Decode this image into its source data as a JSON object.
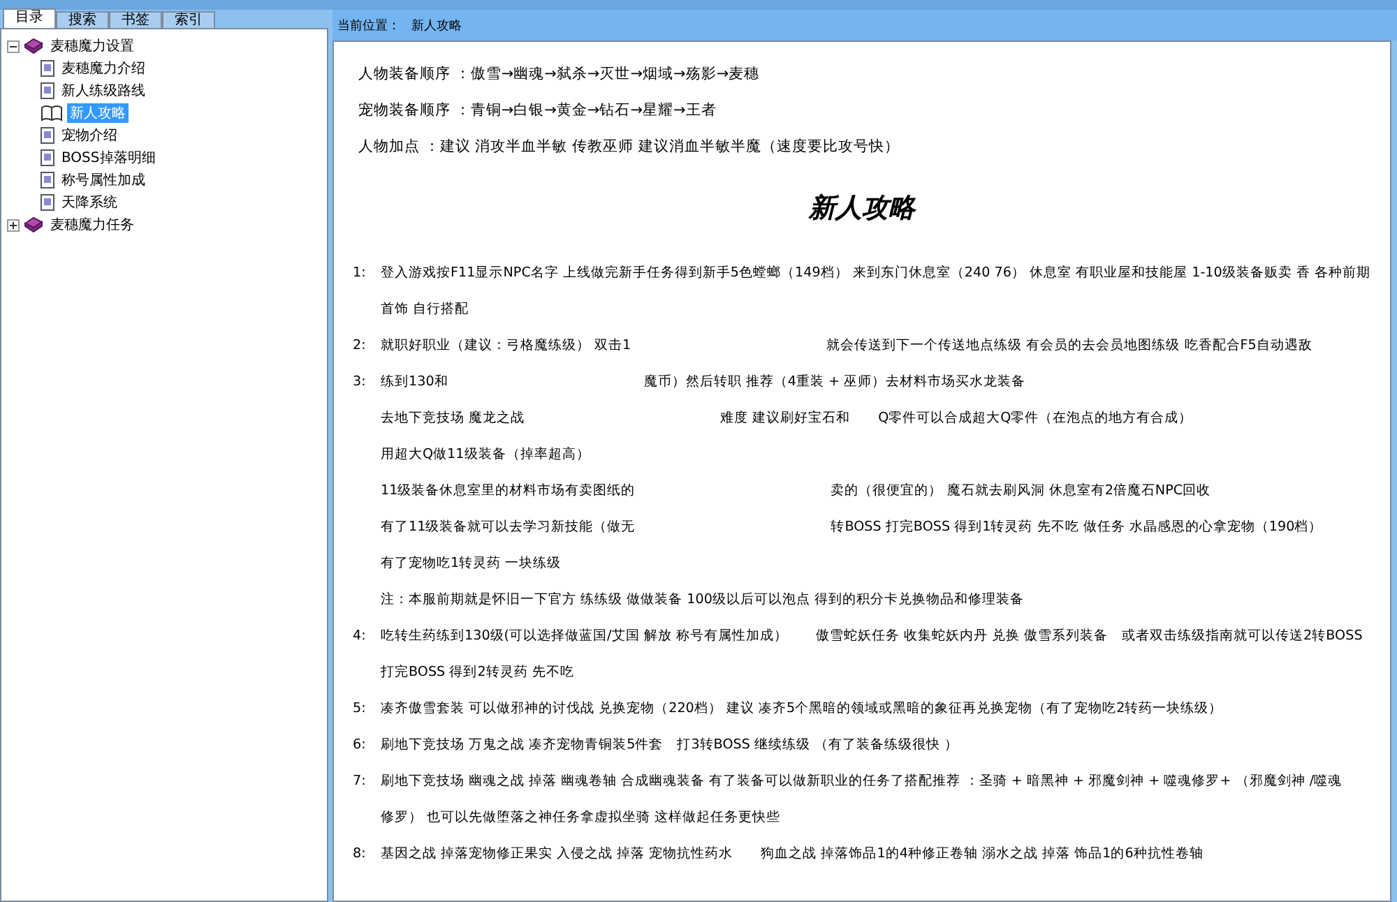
{
  "tabs": [
    {
      "label": "目录",
      "selected": true
    },
    {
      "label": "搜索",
      "selected": false
    },
    {
      "label": "书签",
      "selected": false
    },
    {
      "label": "索引",
      "selected": false
    }
  ],
  "tree": [
    {
      "label": "麦穗魔力设置",
      "expanded": true,
      "children": [
        {
          "label": "麦穗魔力介绍",
          "selected": false
        },
        {
          "label": "新人练级路线",
          "selected": false
        },
        {
          "label": "新人攻略",
          "selected": true
        },
        {
          "label": "宠物介绍",
          "selected": false
        },
        {
          "label": "BOSS掉落明细",
          "selected": false
        },
        {
          "label": "称号属性加成",
          "selected": false
        },
        {
          "label": "天降系统",
          "selected": false
        }
      ]
    },
    {
      "label": "麦穗魔力任务",
      "expanded": false
    }
  ],
  "location": {
    "label": "当前位置：",
    "value": "新人攻略"
  },
  "intro": [
    "人物装备顺序 ：傲雪→幽魂→弑杀→灭世→烟域→殇影→麦穗",
    "宠物装备顺序 ：青铜→白银→黄金→钻石→星耀→王者",
    "人物加点 ：建议 消攻半血半敏 传教巫师 建议消血半敏半魔（速度要比攻号快）"
  ],
  "heading": "新人攻略",
  "lines": [
    {
      "kind": "numbered",
      "number": "1:",
      "parts": [
        "登入游戏按F11显示NPC名字 上线做完新手任务得到新手5色螳螂（149档） 来到东门休息室（240 76） 休息室 有职业屋和技能屋 1-10级装备贩卖 香 各种前期"
      ]
    },
    {
      "kind": "indent",
      "parts": [
        "首饰 自行搭配"
      ]
    },
    {
      "kind": "numbered",
      "number": "2:",
      "parts": [
        "就职好职业（建议：弓格魔练级） 双击1",
        "就会传送到下一个传送地点练级 有会员的去会员地图练级 吃香配合F5自动遇敌"
      ]
    },
    {
      "kind": "numbered",
      "number": "3:",
      "parts": [
        "练到130和",
        "魔币）然后转职 推荐（4重装 + 巫师）去材料市场买水龙装备"
      ]
    },
    {
      "kind": "indent",
      "parts": [
        "去地下竞技场 魔龙之战",
        "难度 建议刷好宝石和　　Q零件可以合成超大Q零件（在泡点的地方有合成）"
      ]
    },
    {
      "kind": "indent",
      "parts": [
        "用超大Q做11级装备（掉率超高）"
      ]
    },
    {
      "kind": "indent",
      "parts": [
        "11级装备休息室里的材料市场有卖图纸的",
        "卖的（很便宜的） 魔石就去刷风洞 休息室有2倍魔石NPC回收"
      ]
    },
    {
      "kind": "indent",
      "parts": [
        "有了11级装备就可以去学习新技能（做无",
        "转BOSS 打完BOSS 得到1转灵药 先不吃 做任务 水晶感恩的心拿宠物（190档）"
      ]
    },
    {
      "kind": "indent",
      "parts": [
        "有了宠物吃1转灵药 一块练级"
      ]
    },
    {
      "kind": "indent",
      "parts": [
        "注：本服前期就是怀旧一下官方 练练级 做做装备 100级以后可以泡点 得到的积分卡兑换物品和修理装备"
      ]
    },
    {
      "kind": "numbered",
      "number": "4:",
      "parts": [
        "吃转生药练到130级(可以选择做蓝国/艾国 解放 称号有属性加成）　　傲雪蛇妖任务 收集蛇妖内丹 兑换 傲雪系列装备　或者双击练级指南就可以传送2转BOSS"
      ]
    },
    {
      "kind": "indent",
      "parts": [
        "打完BOSS 得到2转灵药 先不吃"
      ]
    },
    {
      "kind": "numbered",
      "number": "5:",
      "parts": [
        "凑齐傲雪套装 可以做邪神的讨伐战 兑换宠物（220档） 建议 凑齐5个黑暗的领域或黑暗的象征再兑换宠物（有了宠物吃2转药一块练级）"
      ]
    },
    {
      "kind": "numbered",
      "number": "6:",
      "parts": [
        "刷地下竞技场 万鬼之战 凑齐宠物青铜装5件套　打3转BOSS 继续练级 （有了装备练级很快 ）"
      ]
    },
    {
      "kind": "numbered",
      "number": "7:",
      "parts": [
        "刷地下竞技场 幽魂之战 掉落 幽魂卷轴 合成幽魂装备 有了装备可以做新职业的任务了搭配推荐 ：圣骑 + 暗黑神 + 邪魔剑神 + 噬魂修罗+ （邪魔剑神 /噬魂"
      ]
    },
    {
      "kind": "indent",
      "parts": [
        "修罗） 也可以先做堕落之神任务拿虚拟坐骑 这样做起任务更快些"
      ]
    },
    {
      "kind": "numbered",
      "number": "8:",
      "parts": [
        "基因之战 掉落宠物修正果实 入侵之战 掉落 宠物抗性药水　　狗血之战 掉落饰品1的4种修正卷轴 溺水之战 掉落 饰品1的6种抗性卷轴"
      ]
    }
  ]
}
